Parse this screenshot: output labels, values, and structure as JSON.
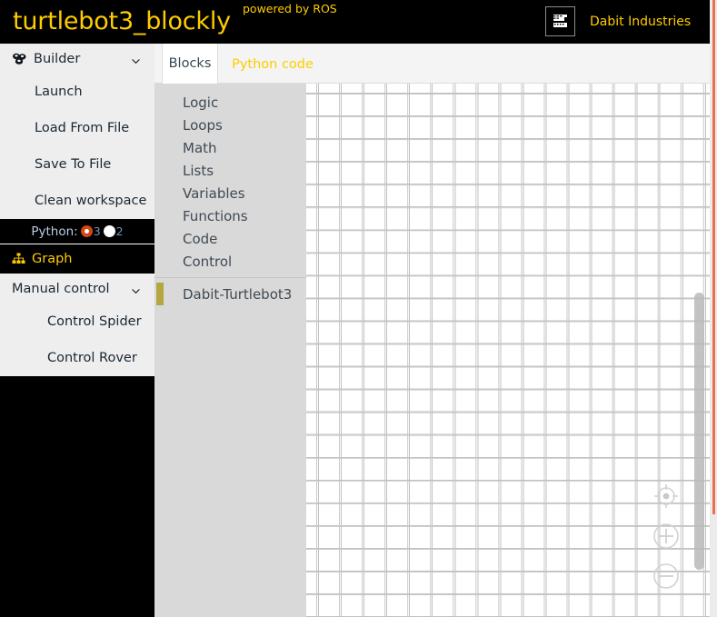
{
  "header": {
    "app_title": "turtlebot3_blockly",
    "powered_by": "powered by ROS",
    "brand_name": "Dabit Industries",
    "brand_logo_icon": "dabit-logo-icon",
    "title_color": "#ffcc00",
    "background_color": "#000000"
  },
  "sidebar": {
    "builder": {
      "label": "Builder",
      "icon": "cubes-icon",
      "chevron": "chevron-down-icon",
      "items": [
        {
          "label": "Launch"
        },
        {
          "label": "Load From File"
        },
        {
          "label": "Save To File"
        },
        {
          "label": "Clean workspace"
        }
      ]
    },
    "python": {
      "label": "Python:",
      "options": [
        {
          "value": "3",
          "selected": true
        },
        {
          "value": "2",
          "selected": false
        }
      ],
      "selected_color": "#d34615",
      "unselected_color": "#ffffff"
    },
    "graph": {
      "label": "Graph",
      "icon": "sitemap-icon",
      "color": "#ffcc00"
    },
    "manual_control": {
      "label": "Manual control",
      "chevron": "chevron-down-icon",
      "items": [
        {
          "label": "Control Spider"
        },
        {
          "label": "Control Rover"
        }
      ]
    }
  },
  "tabs": [
    {
      "label": "Blocks",
      "active": true
    },
    {
      "label": "Python code",
      "active": false
    }
  ],
  "toolbox": {
    "categories": [
      {
        "label": "Logic",
        "selected": false
      },
      {
        "label": "Loops",
        "selected": false
      },
      {
        "label": "Math",
        "selected": false
      },
      {
        "label": "Lists",
        "selected": false
      },
      {
        "label": "Variables",
        "selected": false
      },
      {
        "label": "Functions",
        "selected": false
      },
      {
        "label": "Code",
        "selected": false
      },
      {
        "label": "Control",
        "selected": false
      }
    ],
    "custom_categories": [
      {
        "label": "Dabit-Turtlebot3",
        "selected": true,
        "marker_color": "#b5a642"
      }
    ]
  },
  "workspace": {
    "grid_color": "#c8c8c8",
    "background_color": "#ffffff",
    "zoom_controls": [
      {
        "name": "zoom-center-icon",
        "label": "center"
      },
      {
        "name": "zoom-in-icon",
        "label": "+"
      },
      {
        "name": "zoom-out-icon",
        "label": "-"
      }
    ],
    "scrollbar": {
      "name": "workspace-vertical-scrollbar"
    }
  },
  "browser_scrollbar": {
    "thumb_color": "#e8734a",
    "track_color": "#ebebeb"
  }
}
